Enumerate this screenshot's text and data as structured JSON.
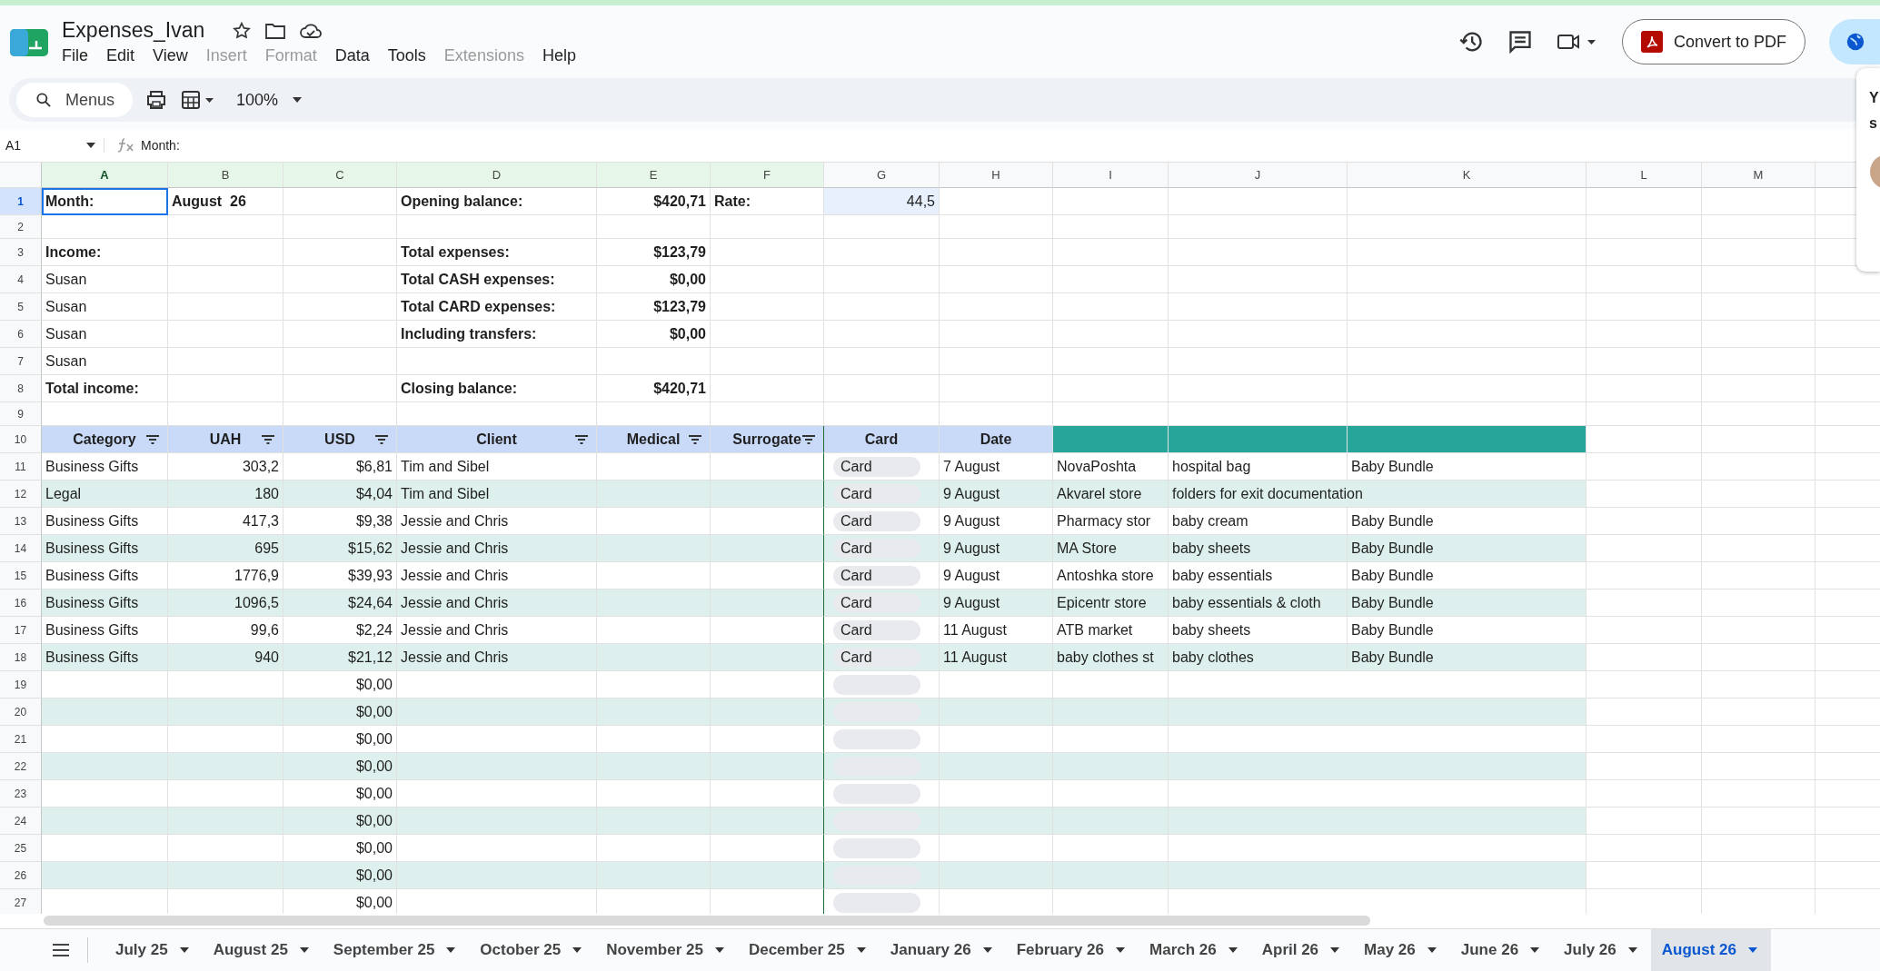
{
  "doc": {
    "title": "Expenses_Ivan"
  },
  "menus": [
    {
      "label": "File",
      "disabled": false
    },
    {
      "label": "Edit",
      "disabled": false
    },
    {
      "label": "View",
      "disabled": false
    },
    {
      "label": "Insert",
      "disabled": true
    },
    {
      "label": "Format",
      "disabled": true
    },
    {
      "label": "Data",
      "disabled": false
    },
    {
      "label": "Tools",
      "disabled": false
    },
    {
      "label": "Extensions",
      "disabled": true
    },
    {
      "label": "Help",
      "disabled": false
    }
  ],
  "convert_button": "Convert to PDF",
  "popup": {
    "line_1": "Y",
    "line_2": "s"
  },
  "toolbar": {
    "search": "Menus",
    "zoom": "100%"
  },
  "formula_bar": {
    "cell": "A1",
    "value": "Month:"
  },
  "columns": [
    {
      "letter": "A",
      "selected": true,
      "in_range": true
    },
    {
      "letter": "B",
      "selected": false,
      "in_range": true
    },
    {
      "letter": "C",
      "selected": false,
      "in_range": true
    },
    {
      "letter": "D",
      "selected": false,
      "in_range": true
    },
    {
      "letter": "E",
      "selected": false,
      "in_range": true
    },
    {
      "letter": "F",
      "selected": false,
      "in_range": true
    },
    {
      "letter": "G",
      "selected": false,
      "in_range": false
    },
    {
      "letter": "H",
      "selected": false,
      "in_range": false
    },
    {
      "letter": "I",
      "selected": false,
      "in_range": false
    },
    {
      "letter": "J",
      "selected": false,
      "in_range": false
    },
    {
      "letter": "K",
      "selected": false,
      "in_range": false
    },
    {
      "letter": "L",
      "selected": false,
      "in_range": false
    },
    {
      "letter": "M",
      "selected": false,
      "in_range": false
    }
  ],
  "summary_rows": [
    {
      "num": "1",
      "selected": true,
      "cells": {
        "a": {
          "text": "Month:",
          "bold": true,
          "selected": true,
          "highlighted": false
        },
        "b": {
          "text": "August  26",
          "bold": true,
          "selected": false,
          "highlighted": false
        },
        "d": {
          "text": "Opening balance:",
          "bold": true,
          "selected": false,
          "highlighted": false
        },
        "e": {
          "text": "$420,71",
          "bold": true,
          "selected": false,
          "highlighted": false
        },
        "f": {
          "text": "Rate:",
          "bold": true,
          "selected": false,
          "highlighted": false
        },
        "g": {
          "text": "44,5",
          "bold": false,
          "selected": false,
          "highlighted": true
        }
      }
    },
    {
      "num": "2",
      "selected": false
    },
    {
      "num": "3",
      "selected": false,
      "cells": {
        "a": {
          "text": "Income:",
          "bold": true,
          "selected": false,
          "highlighted": false
        },
        "d": {
          "text": "Total expenses:",
          "bold": true,
          "selected": false,
          "highlighted": false
        },
        "e": {
          "text": "$123,79",
          "bold": true,
          "selected": false,
          "highlighted": false
        }
      }
    },
    {
      "num": "4",
      "selected": false,
      "cells": {
        "a": {
          "text": "Susan",
          "bold": false,
          "selected": false,
          "highlighted": false
        },
        "d": {
          "text": "Total CASH expenses:",
          "bold": true,
          "selected": false,
          "highlighted": false
        },
        "e": {
          "text": "$0,00",
          "bold": true,
          "selected": false,
          "highlighted": false
        }
      }
    },
    {
      "num": "5",
      "selected": false,
      "cells": {
        "a": {
          "text": "Susan",
          "bold": false,
          "selected": false,
          "highlighted": false
        },
        "d": {
          "text": "Total CARD expenses:",
          "bold": true,
          "selected": false,
          "highlighted": false
        },
        "e": {
          "text": "$123,79",
          "bold": true,
          "selected": false,
          "highlighted": false
        }
      }
    },
    {
      "num": "6",
      "selected": false,
      "cells": {
        "a": {
          "text": "Susan",
          "bold": false,
          "selected": false,
          "highlighted": false
        },
        "d": {
          "text": "Including transfers:",
          "bold": true,
          "selected": false,
          "highlighted": false
        },
        "e": {
          "text": "$0,00",
          "bold": true,
          "selected": false,
          "highlighted": false
        }
      }
    },
    {
      "num": "7",
      "selected": false,
      "cells": {
        "a": {
          "text": "Susan",
          "bold": false,
          "selected": false,
          "highlighted": false
        }
      }
    },
    {
      "num": "8",
      "selected": false,
      "cells": {
        "a": {
          "text": "Total income:",
          "bold": true,
          "selected": false,
          "highlighted": false
        },
        "d": {
          "text": "Closing balance:",
          "bold": true,
          "selected": false,
          "highlighted": false
        },
        "e": {
          "text": "$420,71",
          "bold": true,
          "selected": false,
          "highlighted": false
        }
      }
    },
    {
      "num": "9",
      "selected": false
    }
  ],
  "header_row": {
    "num": "10",
    "cells": [
      {
        "text": "Category",
        "filter": true,
        "color": "#c9daf8"
      },
      {
        "text": "UAH",
        "filter": true,
        "color": "#c9daf8"
      },
      {
        "text": "USD",
        "filter": true,
        "color": "#c9daf8"
      },
      {
        "text": "Client",
        "filter": true,
        "color": "#c9daf8"
      },
      {
        "text": "Medical",
        "filter": true,
        "color": "#c9daf8"
      },
      {
        "text": "Surrogate",
        "filter": true,
        "color": "#c9daf8"
      },
      {
        "text": "Card",
        "filter": false,
        "color": "#c9daf8"
      },
      {
        "text": "Date",
        "filter": false,
        "color": "#c9daf8"
      },
      {
        "filter": false,
        "color": "#26a69a"
      },
      {
        "filter": false,
        "color": "#26a69a"
      },
      {
        "filter": false,
        "color": "#26a69a"
      }
    ]
  },
  "expense_rows": [
    {
      "num": "11",
      "category": "Business Gifts",
      "uah": "303,2",
      "usd": "$6,81",
      "client": "Tim and Sibel",
      "card": "Card",
      "date": "7 August",
      "store": "NovaPoshta",
      "item": "hospital bag",
      "bundle": "Baby Bundle"
    },
    {
      "num": "12",
      "category": "Legal",
      "uah": "180",
      "usd": "$4,04",
      "client": "Tim and Sibel",
      "card": "Card",
      "date": "9 August",
      "store": "Akvarel store",
      "item": "folders for exit documentation"
    },
    {
      "num": "13",
      "category": "Business Gifts",
      "uah": "417,3",
      "usd": "$9,38",
      "client": "Jessie and Chris",
      "card": "Card",
      "date": "9 August",
      "store": "Pharmacy stor",
      "item": "baby cream",
      "bundle": "Baby Bundle"
    },
    {
      "num": "14",
      "category": "Business Gifts",
      "uah": "695",
      "usd": "$15,62",
      "client": "Jessie and Chris",
      "card": "Card",
      "date": "9 August",
      "store": "MA Store",
      "item": "baby sheets",
      "bundle": "Baby Bundle"
    },
    {
      "num": "15",
      "category": "Business Gifts",
      "uah": "1776,9",
      "usd": "$39,93",
      "client": "Jessie and Chris",
      "card": "Card",
      "date": "9 August",
      "store": "Antoshka store",
      "item": "baby essentials",
      "bundle": "Baby Bundle"
    },
    {
      "num": "16",
      "category": "Business Gifts",
      "uah": "1096,5",
      "usd": "$24,64",
      "client": "Jessie and Chris",
      "card": "Card",
      "date": "9 August",
      "store": "Epicentr store",
      "item": "baby essentials & cloth",
      "bundle": "Baby Bundle"
    },
    {
      "num": "17",
      "category": "Business Gifts",
      "uah": "99,6",
      "usd": "$2,24",
      "client": "Jessie and Chris",
      "card": "Card",
      "date": "11 August",
      "store": "ATB market",
      "item": "baby sheets",
      "bundle": "Baby Bundle"
    },
    {
      "num": "18",
      "category": "Business Gifts",
      "uah": "940",
      "usd": "$21,12",
      "client": "Jessie and Chris",
      "card": "Card",
      "date": "11 August",
      "store": "baby clothes st",
      "item": "baby clothes",
      "bundle": "Baby Bundle"
    },
    {
      "num": "19",
      "usd": "$0,00"
    },
    {
      "num": "20",
      "usd": "$0,00"
    },
    {
      "num": "21",
      "usd": "$0,00"
    },
    {
      "num": "22",
      "usd": "$0,00"
    },
    {
      "num": "23",
      "usd": "$0,00"
    },
    {
      "num": "24",
      "usd": "$0,00"
    },
    {
      "num": "25",
      "usd": "$0,00"
    },
    {
      "num": "26",
      "usd": "$0,00"
    },
    {
      "num": "27",
      "usd": "$0,00"
    }
  ],
  "sheet_tabs": [
    {
      "label": "July 25",
      "selected": false
    },
    {
      "label": "August 25",
      "selected": false
    },
    {
      "label": "September 25",
      "selected": false
    },
    {
      "label": "October 25",
      "selected": false
    },
    {
      "label": "November 25",
      "selected": false
    },
    {
      "label": "December 25",
      "selected": false
    },
    {
      "label": "January 26",
      "selected": false
    },
    {
      "label": "February 26",
      "selected": false
    },
    {
      "label": "March 26",
      "selected": false
    },
    {
      "label": "April 26",
      "selected": false
    },
    {
      "label": "May 26",
      "selected": false
    },
    {
      "label": "June 26",
      "selected": false
    },
    {
      "label": "July 26",
      "selected": false
    },
    {
      "label": "August 26",
      "selected": true
    }
  ]
}
